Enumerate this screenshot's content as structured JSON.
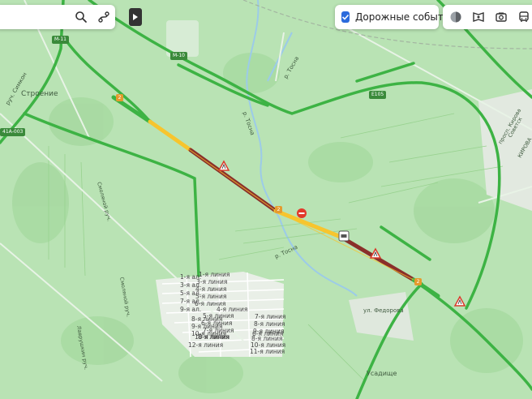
{
  "search_panel": {
    "search_icon": "search-icon",
    "route_icon": "route-icon",
    "collapse_icon": "play-arrow-icon"
  },
  "traffic_panel": {
    "checkbox_checked": true,
    "label": "Дорожные события"
  },
  "layers": {
    "icons": [
      "layers-icon",
      "panorama-icon",
      "camera-icon",
      "transit-icon"
    ]
  },
  "road_badges": {
    "m11": "М-11",
    "m10": "М-10",
    "e105": "Е105",
    "a003": "41А-003",
    "route_num": "2"
  },
  "place_labels": {
    "stroenie": "Строение",
    "ruch_simkon": "руч. Симкон",
    "r_tosna_top": "р. Тосна",
    "r_tosna_mid": "р. Тосна",
    "r_tosna_low": "р. Тосна",
    "smolyanoy_1": "Смоляной руч.",
    "smolyanoy_2": "Смоляной руч.",
    "lavrushkin": "Лаврушкин руч.",
    "sovetsky": "Советск",
    "kirova": "просп. Кирова",
    "kirovsk": "КИРОВА",
    "fedorovka": "ул. Федорова",
    "usadishche": "Усадище"
  },
  "streets": {
    "col1": [
      "1-я ал.",
      "3-я ал.",
      "5-я ал.",
      "7-я ал.",
      "9-я ал."
    ],
    "col2": [
      "1-я линия",
      "3-я линия",
      "4-я линия",
      "5-я линия",
      "6-я линия",
      "8-я линия",
      "9-я линия",
      "10-я линия"
    ],
    "col3": [
      "4-я линия",
      "5-я линия",
      "6-я линия",
      "7-я линия",
      "8-я линия",
      "10-я линия",
      "12-я линия"
    ],
    "col4": [
      "7-я линия",
      "8-я линия",
      "9-я линия",
      "6-я линия",
      "8-я линия",
      "10-я линия",
      "11-я линия"
    ]
  },
  "colors": {
    "map_bg": "#b9e3b4",
    "traffic_free": "#3db344",
    "traffic_slow": "#f7c52e",
    "traffic_jam": "#8a2f2a",
    "water": "#9ccbe8",
    "accent": "#2c6bdc"
  },
  "events": [
    "roadwork-icon",
    "roadwork-icon",
    "road-closed-icon",
    "accident-icon",
    "roadwork-icon",
    "roadwork-icon"
  ]
}
